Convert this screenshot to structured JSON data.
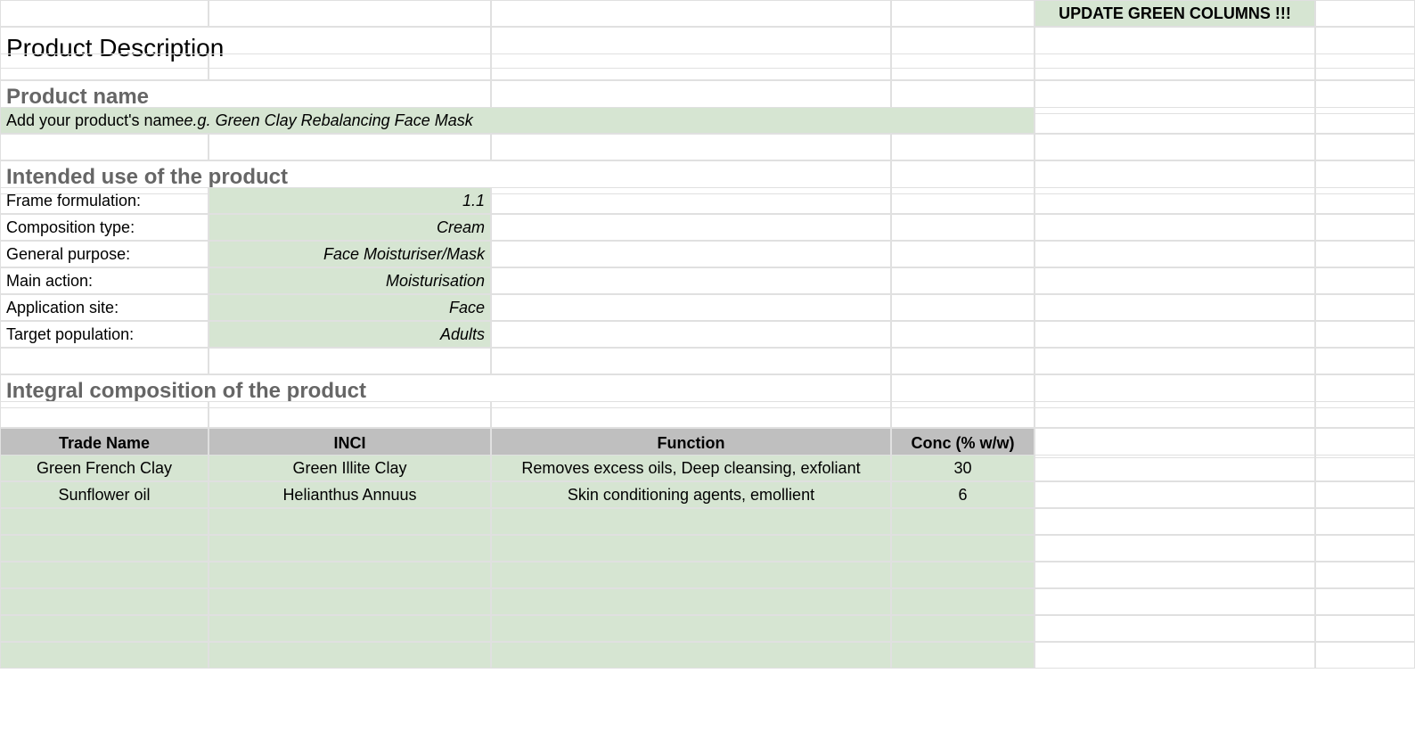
{
  "notice": "UPDATE GREEN COLUMNS !!!",
  "titles": {
    "product_description": "Product Description",
    "product_name": "Product name",
    "intended_use": "Intended use of the product",
    "composition": "Integral composition of the product"
  },
  "product_name_field": {
    "prefix": "Add your product's name ",
    "example": "e.g. Green Clay Rebalancing Face Mask"
  },
  "intended_use": {
    "frame_formulation": {
      "label": "Frame formulation:",
      "value": "1.1"
    },
    "composition_type": {
      "label": "Composition type:",
      "value": "Cream"
    },
    "general_purpose": {
      "label": "General purpose:",
      "value": "Face Moisturiser/Mask"
    },
    "main_action": {
      "label": "Main action:",
      "value": "Moisturisation"
    },
    "application_site": {
      "label": "Application site:",
      "value": "Face"
    },
    "target_population": {
      "label": "Target population:",
      "value": "Adults"
    }
  },
  "table": {
    "headers": {
      "trade_name": "Trade Name",
      "inci": "INCI",
      "function": "Function",
      "conc": "Conc (% w/w)"
    },
    "rows": [
      {
        "trade_name": "Green French Clay",
        "inci": "Green Illite Clay",
        "function": "Removes excess oils, Deep cleansing, exfoliant",
        "conc": "30"
      },
      {
        "trade_name": "Sunflower oil",
        "inci": "Helianthus Annuus",
        "function": "Skin conditioning agents, emollient",
        "conc": "6"
      }
    ]
  }
}
